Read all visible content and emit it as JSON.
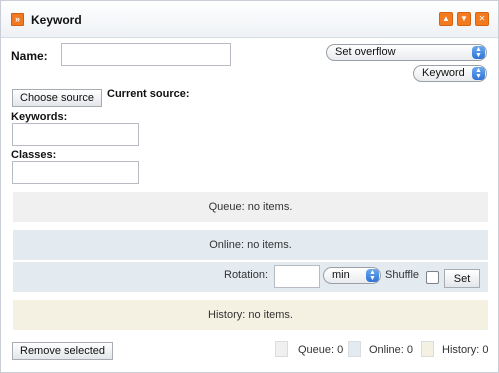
{
  "window": {
    "title": "Keyword",
    "buttons": [
      "minimize",
      "maximize",
      "close"
    ]
  },
  "form": {
    "name_label": "Name:",
    "name_value": "",
    "overflow_select": "Set overflow",
    "type_select": "Keyword",
    "choose_source_label": "Choose source",
    "current_source_label": "Current source:",
    "keywords_label": "Keywords:",
    "keywords_value": "",
    "classes_label": "Classes:",
    "classes_value": ""
  },
  "queue": {
    "text": "Queue: no items."
  },
  "online": {
    "text": "Online: no items.",
    "rotation_label": "Rotation:",
    "rotation_value": "",
    "unit_select": "min",
    "shuffle_label": "Shuffle",
    "shuffle_checked": false,
    "set_label": "Set"
  },
  "history": {
    "text": "History: no items."
  },
  "footer": {
    "remove_label": "Remove selected",
    "queue_count": "Queue: 0",
    "online_count": "Online: 0",
    "history_count": "History: 0"
  },
  "colors": {
    "accent": "#f47a20",
    "queue": "#f0f0f0",
    "online": "#e3ebf1",
    "history": "#f4f1e3"
  }
}
